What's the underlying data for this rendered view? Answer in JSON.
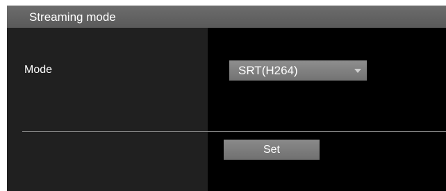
{
  "panel": {
    "title": "Streaming mode"
  },
  "mode": {
    "label": "Mode",
    "selected": "SRT(H264)"
  },
  "actions": {
    "set_label": "Set"
  },
  "colors": {
    "panel_background": "#000000",
    "label_column_background": "#202020",
    "header_background": "#606060",
    "control_background": "#7f7f7f",
    "text": "#ffffff"
  }
}
